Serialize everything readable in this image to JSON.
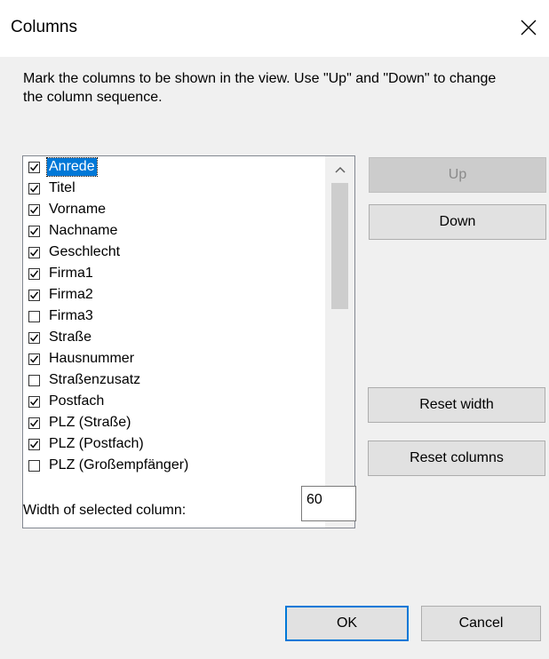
{
  "window": {
    "title": "Columns"
  },
  "instructions": "Mark the columns to be shown in the view. Use \"Up\" and \"Down\" to change the column sequence.",
  "columns": [
    {
      "label": "Anrede",
      "checked": true,
      "selected": true
    },
    {
      "label": "Titel",
      "checked": true
    },
    {
      "label": "Vorname",
      "checked": true
    },
    {
      "label": "Nachname",
      "checked": true
    },
    {
      "label": "Geschlecht",
      "checked": true
    },
    {
      "label": "Firma1",
      "checked": true
    },
    {
      "label": "Firma2",
      "checked": true
    },
    {
      "label": "Firma3",
      "checked": false
    },
    {
      "label": "Straße",
      "checked": true
    },
    {
      "label": "Hausnummer",
      "checked": true
    },
    {
      "label": "Straßenzusatz",
      "checked": false
    },
    {
      "label": "Postfach",
      "checked": true
    },
    {
      "label": "PLZ (Straße)",
      "checked": true
    },
    {
      "label": "PLZ (Postfach)",
      "checked": true
    },
    {
      "label": "PLZ (Großempfänger)",
      "checked": false
    }
  ],
  "buttons": {
    "up": "Up",
    "down": "Down",
    "reset_width": "Reset width",
    "reset_columns": "Reset columns",
    "ok": "OK",
    "cancel": "Cancel"
  },
  "width": {
    "label": "Width of selected column:",
    "value": "60"
  },
  "colors": {
    "accent": "#0078d7",
    "dialog_bg": "#f0f0f0",
    "button_bg": "#e1e1e1"
  }
}
